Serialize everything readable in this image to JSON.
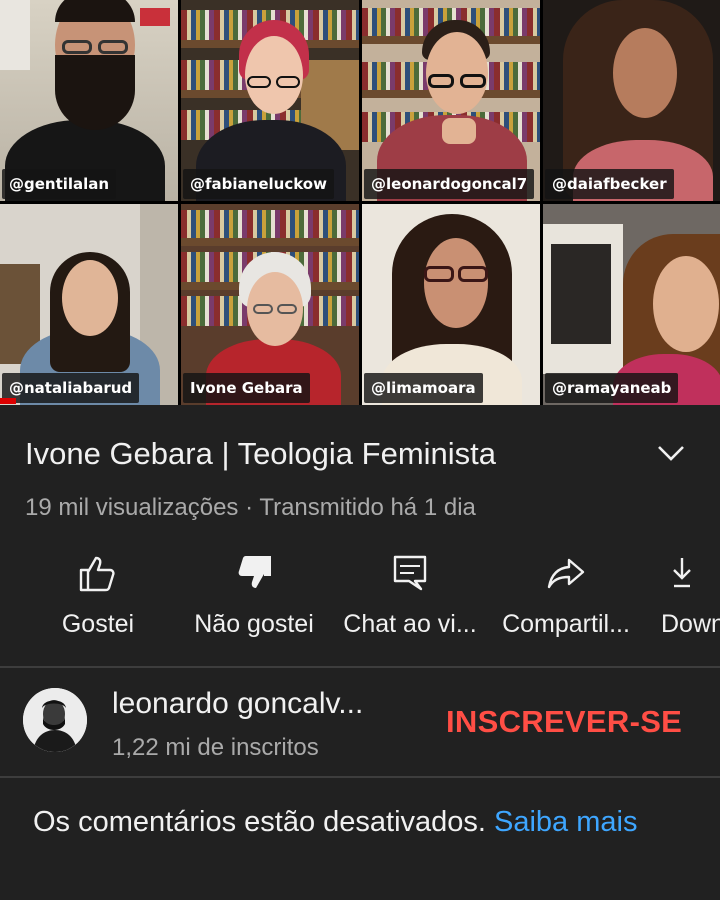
{
  "video": {
    "participants": [
      {
        "handle": "@gentilalan",
        "colors": {
          "bg": "#c9c3b6",
          "head": "#c79377",
          "body": "#1a1a1a",
          "hair": "#1b1410"
        }
      },
      {
        "handle": "@fabianeluckow",
        "colors": {
          "bg": "#3a3026",
          "head": "#efc6ad",
          "body": "#1c1c22",
          "hair": "#c2304a"
        }
      },
      {
        "handle": "@leonardogoncal7",
        "colors": {
          "bg": "#b7a48e",
          "head": "#e2b394",
          "body": "#9e3d46",
          "hair": "#2b1f18"
        }
      },
      {
        "handle": "@daiafbecker",
        "colors": {
          "bg": "#1f1a17",
          "head": "#b67c5d",
          "body": "#c7666b",
          "hair": "#3a2418"
        }
      },
      {
        "handle": "@nataliabarud",
        "colors": {
          "bg": "#d9d4cc",
          "head": "#e0b597",
          "body": "#6d8aa8",
          "hair": "#231912"
        }
      },
      {
        "handle": "Ivone Gebara",
        "colors": {
          "bg": "#5a3d2c",
          "head": "#e6bba0",
          "body": "#b7252c",
          "hair": "#e8e6e2"
        }
      },
      {
        "handle": "@limamoara",
        "colors": {
          "bg": "#ebe6dd",
          "head": "#c99073",
          "body": "#f0e7d8",
          "hair": "#2a1a12"
        }
      },
      {
        "handle": "@ramayaneab",
        "colors": {
          "bg": "#6e6863",
          "head": "#e0b08f",
          "body": "#c0305c",
          "hair": "#6a3d1d"
        }
      }
    ]
  },
  "title": "Ivone Gebara | Teologia Feminista",
  "meta": "19 mil visualizações · Transmitido há 1 dia",
  "actions": [
    {
      "icon": "thumbs-up-icon",
      "label": "Gostei"
    },
    {
      "icon": "thumbs-down-icon",
      "label": "Não gostei"
    },
    {
      "icon": "chat-icon",
      "label": "Chat ao vi..."
    },
    {
      "icon": "share-icon",
      "label": "Compartil..."
    },
    {
      "icon": "download-icon",
      "label": "Down"
    }
  ],
  "channel": {
    "name": "leonardo goncalv...",
    "subscribers": "1,22 mi de inscritos",
    "subscribe_label": "INSCREVER-SE"
  },
  "comments": {
    "text": "Os comentários estão desativados. ",
    "link": "Saiba mais"
  },
  "colors": {
    "accent_red": "#ff4e45",
    "link_blue": "#3ea6ff",
    "background": "#212121"
  }
}
